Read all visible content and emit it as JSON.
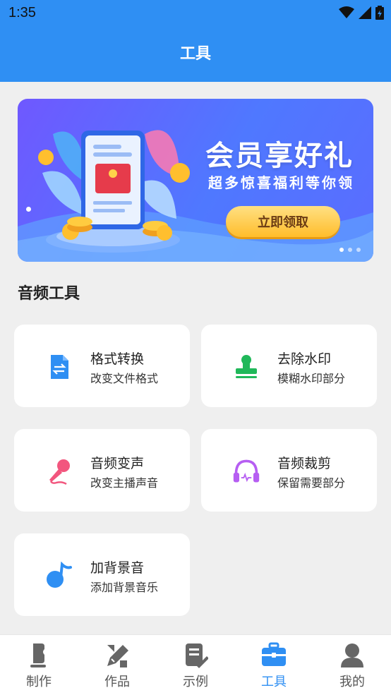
{
  "status_bar": {
    "time": "1:35"
  },
  "header": {
    "title": "工具"
  },
  "banner": {
    "headline": "会员享好礼",
    "subline": "超多惊喜福利等你领",
    "cta_label": "立即领取"
  },
  "section": {
    "title": "音频工具"
  },
  "tools": [
    {
      "name": "格式转换",
      "desc": "改变文件格式",
      "icon": "file-convert-icon",
      "color": "#2f8ff3"
    },
    {
      "name": "去除水印",
      "desc": "模糊水印部分",
      "icon": "stamp-icon",
      "color": "#20b85a"
    },
    {
      "name": "音频变声",
      "desc": "改变主播声音",
      "icon": "microphone-icon",
      "color": "#f2567e"
    },
    {
      "name": "音频裁剪",
      "desc": "保留需要部分",
      "icon": "headphones-icon",
      "color": "#b65ef2"
    },
    {
      "name": "加背景音",
      "desc": "添加背景音乐",
      "icon": "music-note-icon",
      "color": "#2f8ff3"
    }
  ],
  "bottom_nav": [
    {
      "label": "制作",
      "icon": "make-icon"
    },
    {
      "label": "作品",
      "icon": "works-icon"
    },
    {
      "label": "示例",
      "icon": "example-icon"
    },
    {
      "label": "工具",
      "icon": "toolbox-icon",
      "active": true
    },
    {
      "label": "我的",
      "icon": "profile-icon"
    }
  ],
  "colors": {
    "primary": "#2f8ff3",
    "background": "#efefef",
    "inactive_nav": "#555555"
  }
}
